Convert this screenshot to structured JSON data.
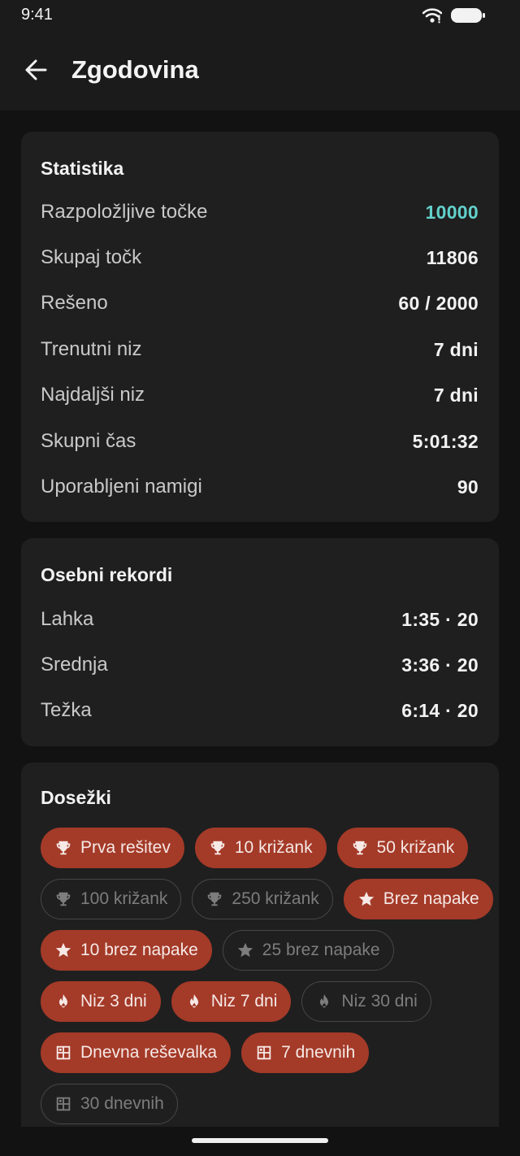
{
  "status": {
    "time": "9:41"
  },
  "appbar": {
    "title": "Zgodovina"
  },
  "stats": {
    "title": "Statistika",
    "rows": [
      {
        "label": "Razpoložljive točke",
        "value": "10000"
      },
      {
        "label": "Skupaj točk",
        "value": "11806"
      },
      {
        "label": "Rešeno",
        "value": "60 / 2000"
      },
      {
        "label": "Trenutni niz",
        "value": "7 dni"
      },
      {
        "label": "Najdaljši niz",
        "value": "7 dni"
      },
      {
        "label": "Skupni čas",
        "value": "5:01:32"
      },
      {
        "label": "Uporabljeni namigi",
        "value": "90"
      }
    ]
  },
  "records": {
    "title": "Osebni rekordi",
    "rows": [
      {
        "label": "Lahka",
        "value": "1:35 · 20"
      },
      {
        "label": "Srednja",
        "value": "3:36 · 20"
      },
      {
        "label": "Težka",
        "value": "6:14 · 20"
      }
    ]
  },
  "achievements": {
    "title": "Dosežki",
    "items": [
      {
        "label": "Prva rešitev",
        "icon": "trophy-icon",
        "unlocked": true
      },
      {
        "label": "10 križank",
        "icon": "trophy-icon",
        "unlocked": true
      },
      {
        "label": "50 križank",
        "icon": "trophy-icon",
        "unlocked": true
      },
      {
        "label": "100 križank",
        "icon": "trophy-icon",
        "unlocked": false
      },
      {
        "label": "250 križank",
        "icon": "trophy-icon",
        "unlocked": false
      },
      {
        "label": "Brez napake",
        "icon": "star-icon",
        "unlocked": true
      },
      {
        "label": "10 brez napake",
        "icon": "star-icon",
        "unlocked": true
      },
      {
        "label": "25 brez napake",
        "icon": "star-icon",
        "unlocked": false
      },
      {
        "label": "Niz 3 dni",
        "icon": "flame-icon",
        "unlocked": true
      },
      {
        "label": "Niz 7 dni",
        "icon": "flame-icon",
        "unlocked": true
      },
      {
        "label": "Niz 30 dni",
        "icon": "flame-icon",
        "unlocked": false
      },
      {
        "label": "Dnevna reševalka",
        "icon": "calendar-grid-icon",
        "unlocked": true
      },
      {
        "label": "7 dnevnih",
        "icon": "calendar-grid-icon",
        "unlocked": true
      },
      {
        "label": "30 dnevnih",
        "icon": "calendar-grid-icon",
        "unlocked": false
      }
    ]
  },
  "colors": {
    "accent": "#62d0cb",
    "chip_active": "#a43a28",
    "card": "#1f1f1f",
    "background": "#121212"
  }
}
